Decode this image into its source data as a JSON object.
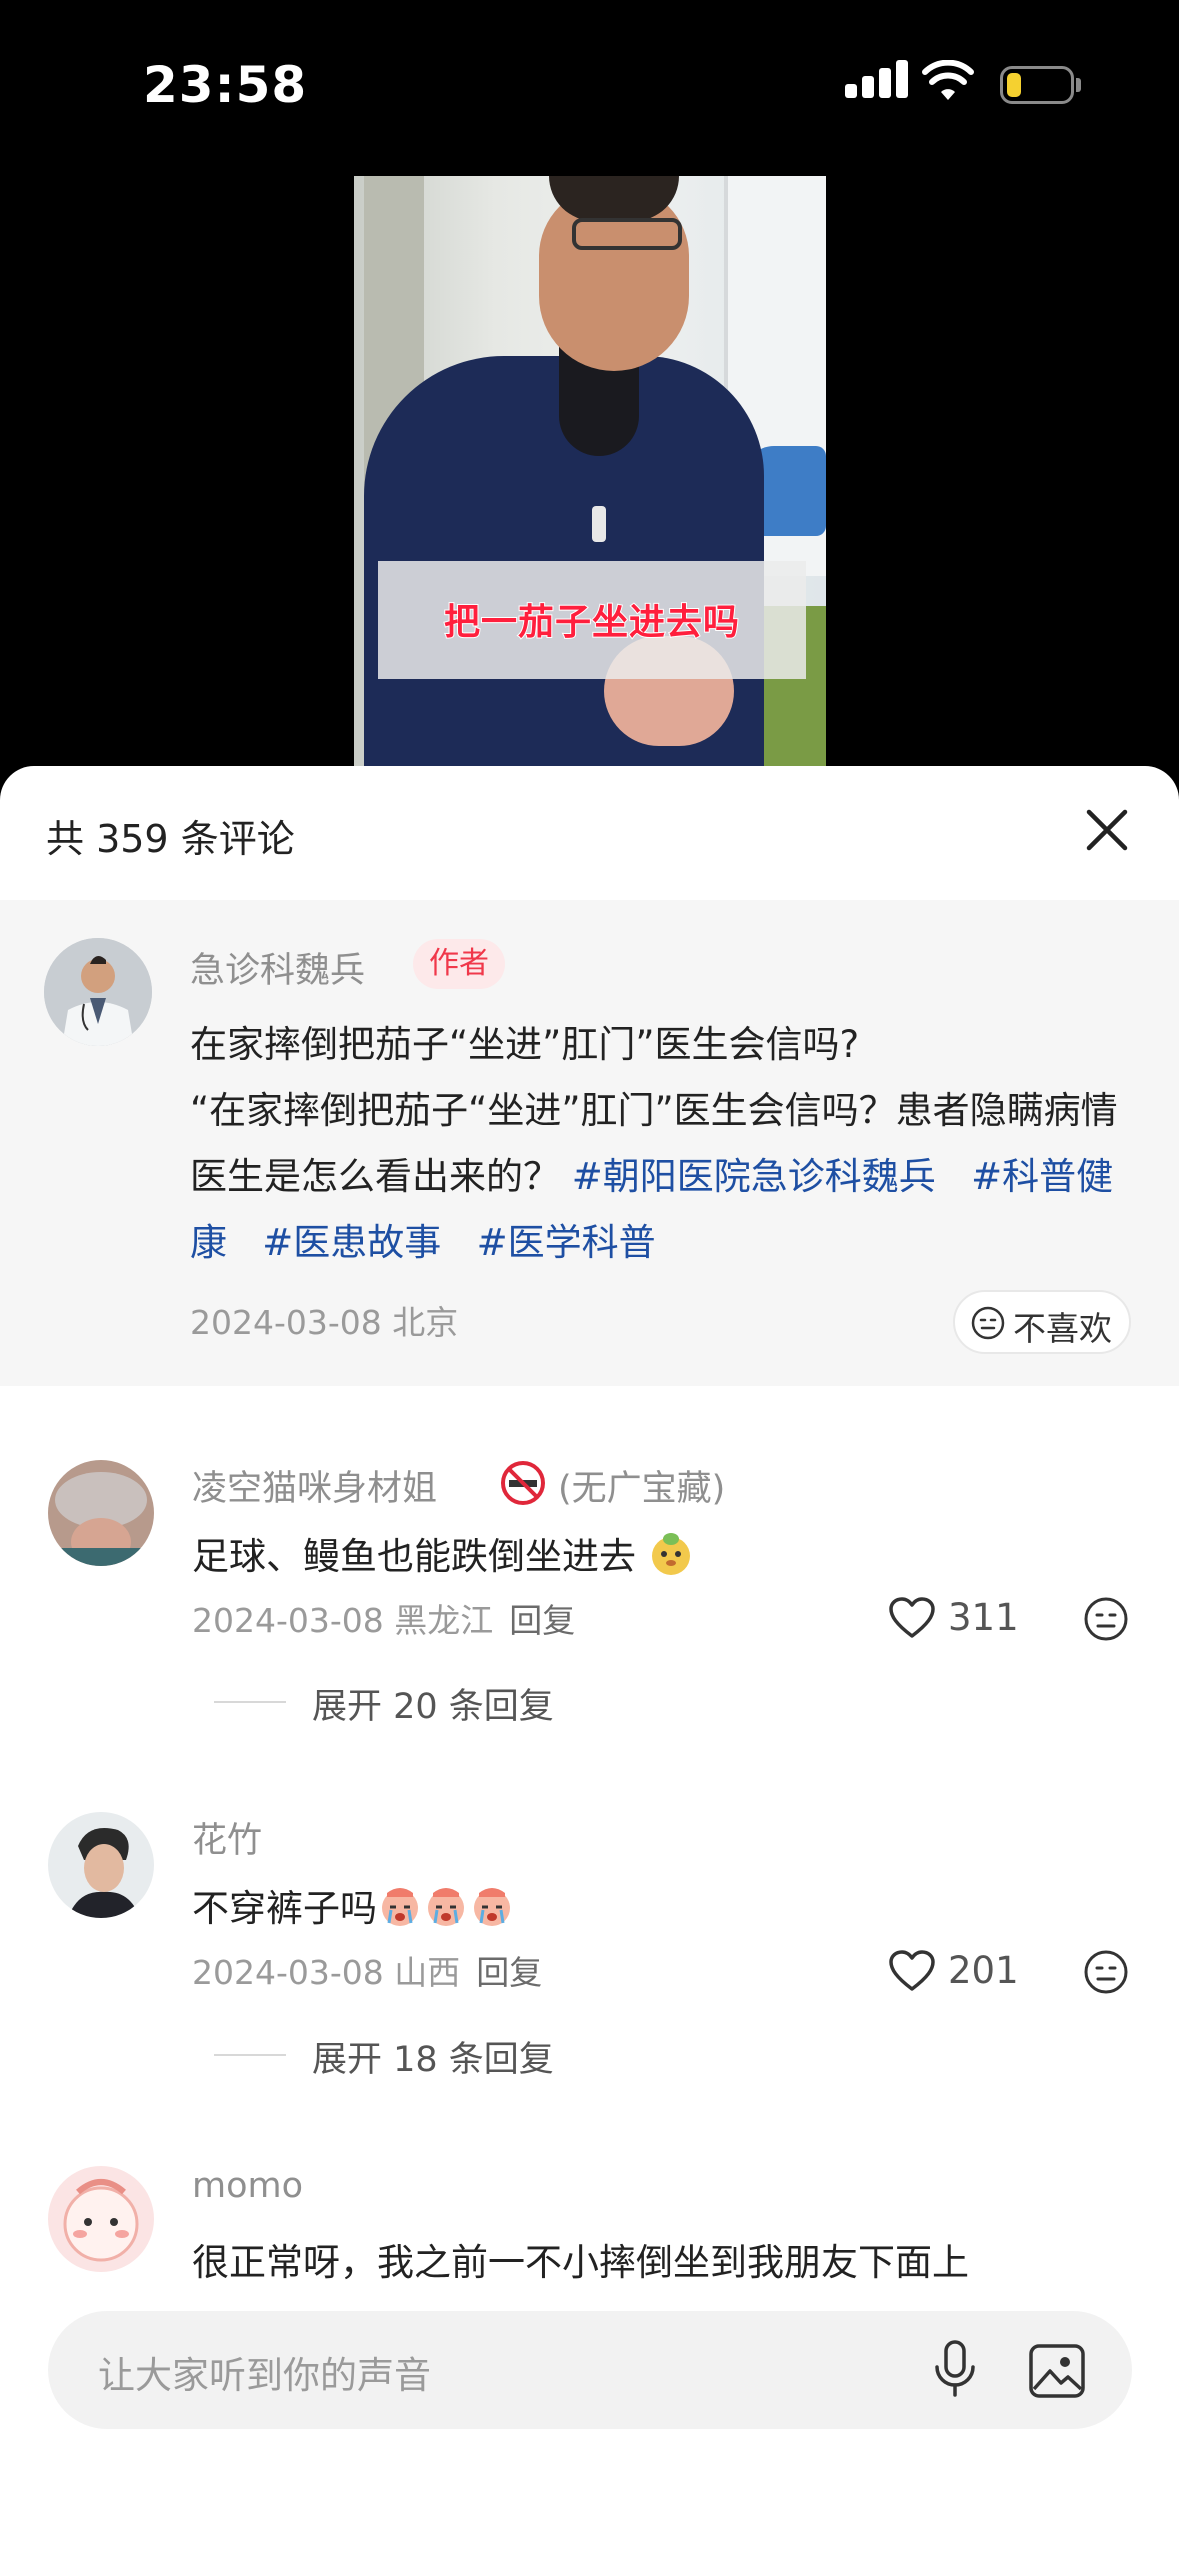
{
  "status": {
    "time": "23:58"
  },
  "video": {
    "caption": "把一茄子坐进去吗"
  },
  "sheet": {
    "count_label": "共 359 条评论"
  },
  "author_post": {
    "name": "急诊科魏兵",
    "tag": "作者",
    "text_line1": "在家摔倒把茄子“坐进”肛门”医生会信吗?",
    "text_body": "“在家摔倒把茄子“坐进”肛门”医生会信吗？患者隐瞒病情 医生是怎么看出来的？ ",
    "hashtags": [
      "#朝阳医院急诊科魏兵",
      "#科普健康",
      "#医患故事",
      "#医学科普"
    ],
    "date_loc": "2024-03-08 北京",
    "dislike_label": "不喜欢"
  },
  "comments": [
    {
      "name": "凌空猫咪身材姐",
      "name_suffix": "(无广宝藏)",
      "text": "足球、鳗鱼也能跌倒坐进去",
      "date_loc": "2024-03-08 黑龙江",
      "reply_label": "回复",
      "likes": "311",
      "expand_label": "展开 20 条回复"
    },
    {
      "name": "花竹",
      "text": "不穿裤子吗",
      "date_loc": "2024-03-08 山西",
      "reply_label": "回复",
      "likes": "201",
      "expand_label": "展开 18 条回复"
    },
    {
      "name": "momo",
      "text": "很正常呀，我之前一不小摔倒坐到我朋友下面上"
    }
  ],
  "input": {
    "placeholder": "让大家听到你的声音"
  }
}
